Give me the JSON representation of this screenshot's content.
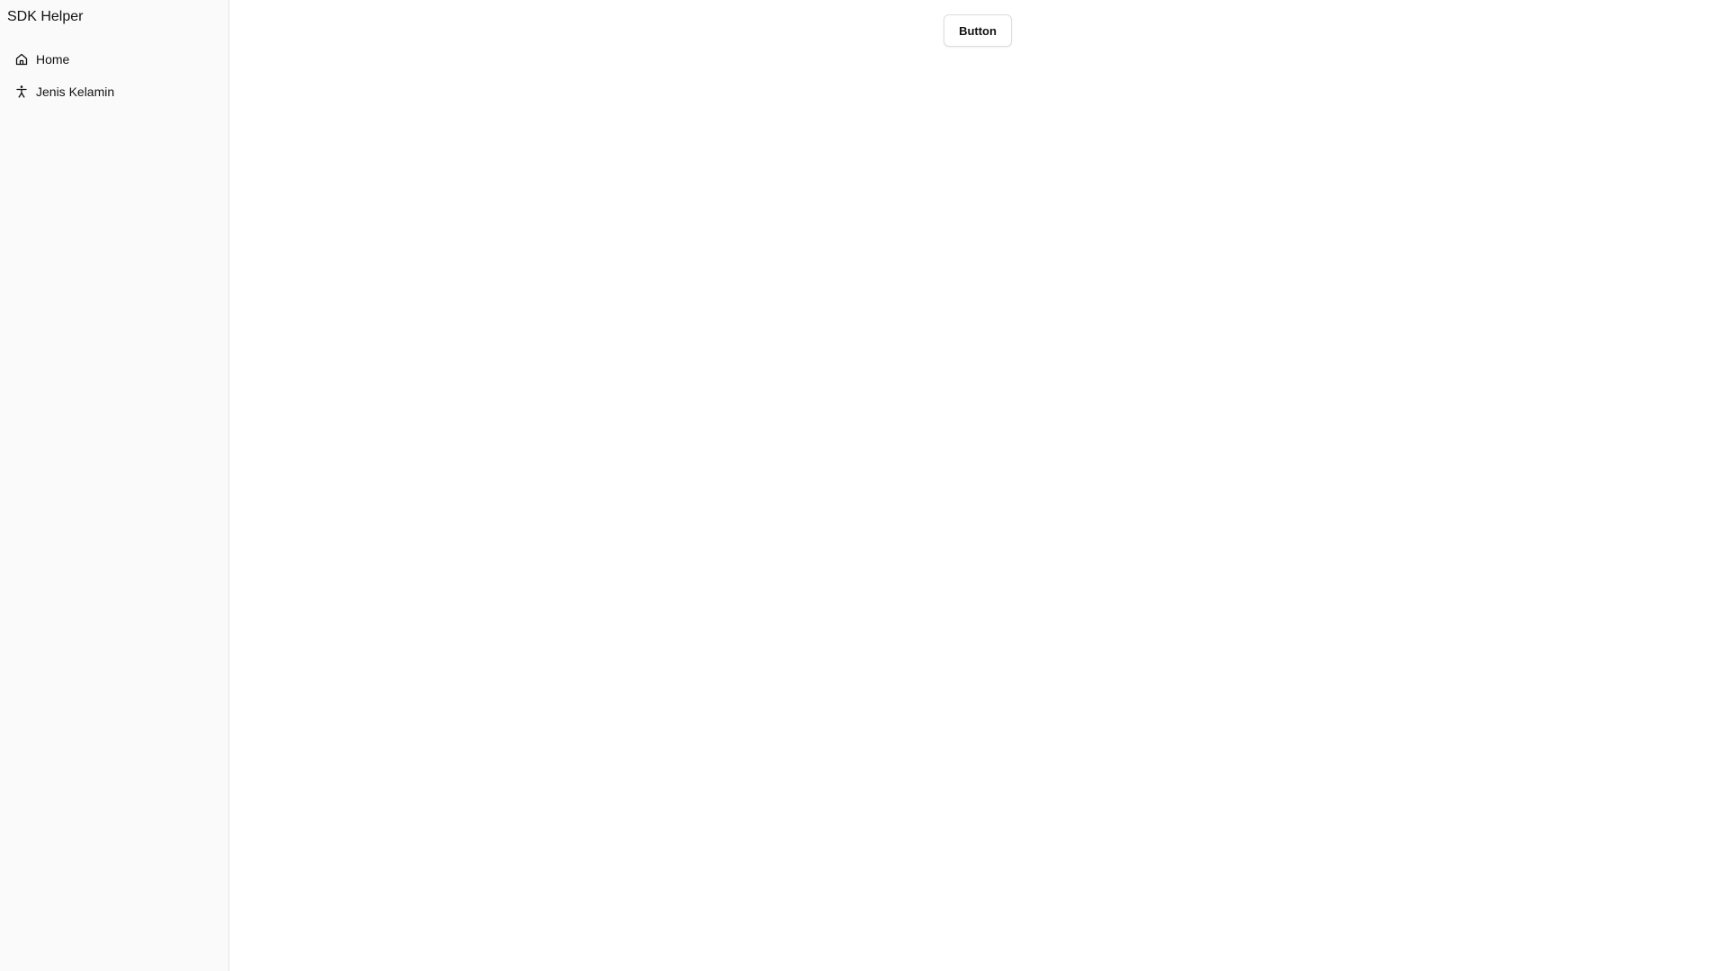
{
  "app": {
    "title": "SDK Helper"
  },
  "sidebar": {
    "items": [
      {
        "label": "Home",
        "icon": "home-icon"
      },
      {
        "label": "Jenis Kelamin",
        "icon": "person-icon"
      }
    ]
  },
  "main": {
    "button_label": "Button"
  },
  "colors": {
    "sidebar_background": "#fafafa",
    "sidebar_border": "#e6e6e6",
    "main_background": "#ffffff",
    "button_border": "#dddddd",
    "text": "#111111"
  }
}
